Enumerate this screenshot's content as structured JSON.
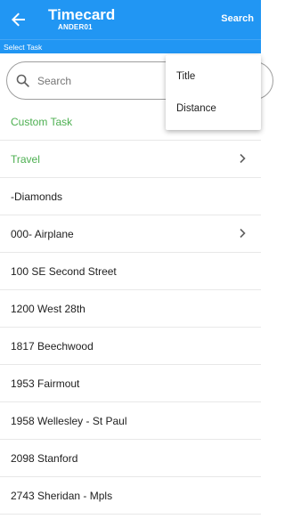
{
  "appbar": {
    "title": "Timecard",
    "subtitle": "ANDER01",
    "search_action": "Search",
    "back_icon": "arrow-left-icon"
  },
  "subheader": {
    "label": "Select Task"
  },
  "search": {
    "placeholder": "Search",
    "value": "",
    "icon": "search-icon"
  },
  "list": {
    "items": [
      {
        "label": "Custom Task",
        "style": "green",
        "has_chevron": false
      },
      {
        "label": "Travel",
        "style": "green",
        "has_chevron": true
      },
      {
        "label": "-Diamonds",
        "style": "normal",
        "has_chevron": false
      },
      {
        "label": "000- Airplane",
        "style": "normal",
        "has_chevron": true
      },
      {
        "label": "100 SE Second Street",
        "style": "normal",
        "has_chevron": false
      },
      {
        "label": "1200 West 28th",
        "style": "normal",
        "has_chevron": false
      },
      {
        "label": "1817 Beechwood",
        "style": "normal",
        "has_chevron": false
      },
      {
        "label": "1953 Fairmout",
        "style": "normal",
        "has_chevron": false
      },
      {
        "label": "1958 Wellesley - St Paul",
        "style": "normal",
        "has_chevron": false
      },
      {
        "label": "2098 Stanford",
        "style": "normal",
        "has_chevron": false
      },
      {
        "label": "2743 Sheridan - Mpls",
        "style": "normal",
        "has_chevron": false
      }
    ]
  },
  "sort_menu": {
    "items": [
      {
        "label": "Title"
      },
      {
        "label": "Distance"
      }
    ]
  },
  "colors": {
    "primary": "#2196f3",
    "accent_green": "#4caf50",
    "divider": "#e8e8e8"
  }
}
